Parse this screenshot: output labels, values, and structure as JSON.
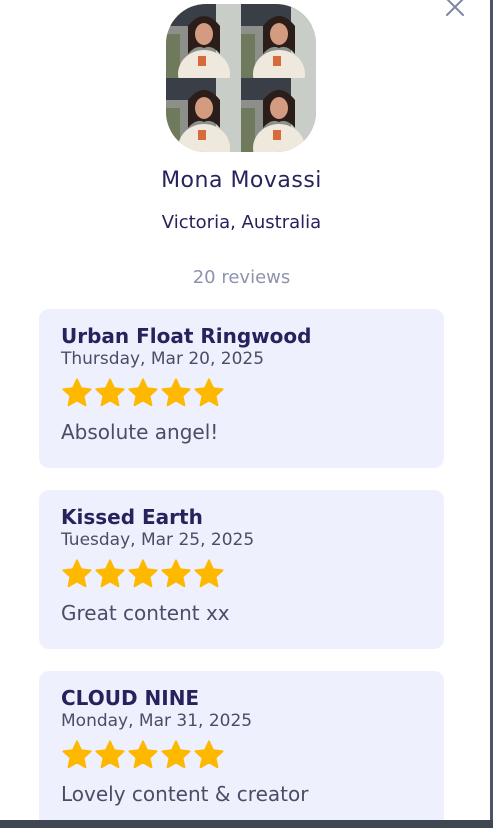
{
  "profile": {
    "name": "Mona Movassi",
    "location": "Victoria, Australia",
    "reviews_count": "20 reviews"
  },
  "reviews": [
    {
      "venue": "Urban Float Ringwood",
      "date": "Thursday, Mar 20, 2025",
      "rating": 5,
      "text": "Absolute angel!"
    },
    {
      "venue": "Kissed Earth",
      "date": "Tuesday, Mar 25, 2025",
      "rating": 5,
      "text": "Great content xx"
    },
    {
      "venue": "CLOUD NINE",
      "date": "Monday, Mar 31, 2025",
      "rating": 5,
      "text": "Lovely content & creator"
    }
  ],
  "colors": {
    "primary_text": "#26235c",
    "muted_text": "#8d93ad",
    "card_bg": "#eef1fd",
    "star": "#ffb800"
  },
  "icons": {
    "close": "close-icon",
    "star": "star-icon"
  }
}
